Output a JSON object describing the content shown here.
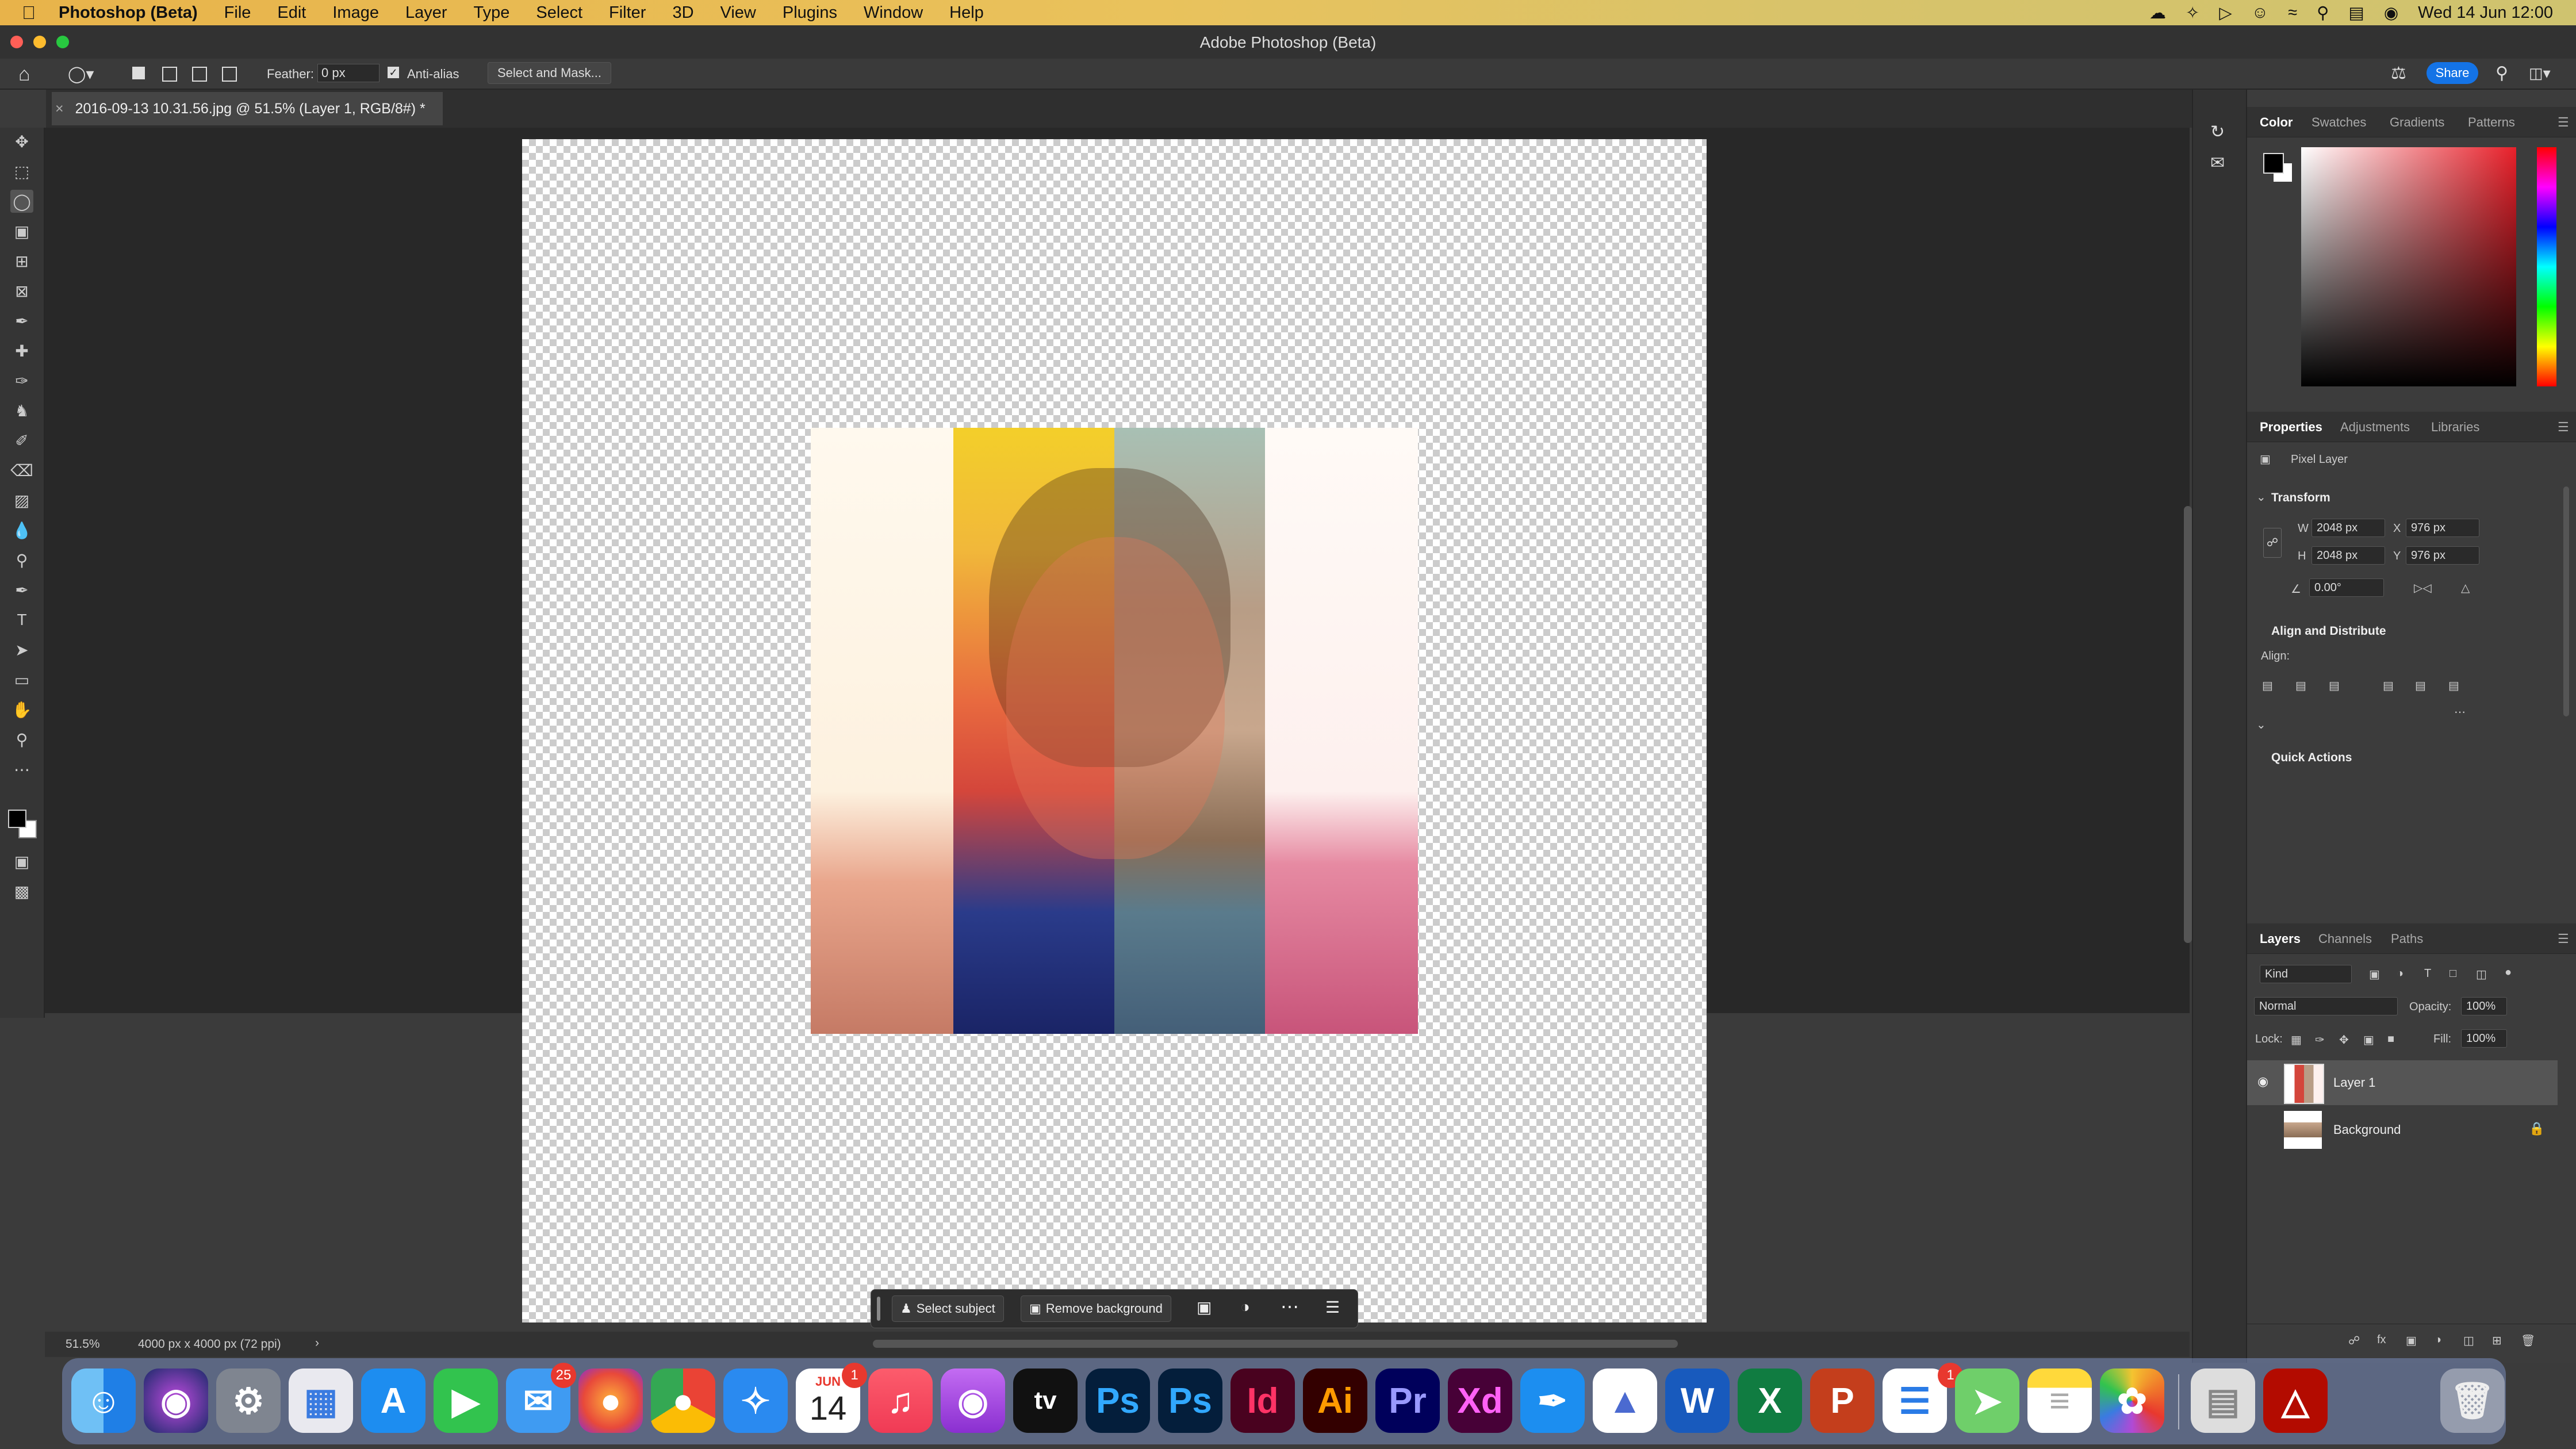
{
  "menubar": {
    "app_name": "Photoshop (Beta)",
    "items": [
      "File",
      "Edit",
      "Image",
      "Layer",
      "Type",
      "Select",
      "Filter",
      "3D",
      "View",
      "Plugins",
      "Window",
      "Help"
    ],
    "clock": "Wed 14 Jun  12:00"
  },
  "window": {
    "title": "Adobe Photoshop (Beta)"
  },
  "options": {
    "feather_label": "Feather:",
    "feather_value": "0 px",
    "antialias_label": "Anti-alias",
    "select_mask_label": "Select and Mask...",
    "share_label": "Share"
  },
  "document": {
    "tab_title": "2016-09-13 10.31.56.jpg @ 51.5% (Layer 1, RGB/8#) *"
  },
  "status": {
    "zoom": "51.5%",
    "doc_info": "4000 px x 4000 px (72 ppi)"
  },
  "context_bar": {
    "select_subject": "Select subject",
    "remove_background": "Remove background"
  },
  "color_panel": {
    "tabs": [
      "Color",
      "Swatches",
      "Gradients",
      "Patterns"
    ]
  },
  "properties": {
    "tabs": [
      "Properties",
      "Adjustments",
      "Libraries"
    ],
    "layer_type": "Pixel Layer",
    "transform_label": "Transform",
    "w_label": "W",
    "w_value": "2048 px",
    "h_label": "H",
    "h_value": "2048 px",
    "x_label": "X",
    "x_value": "976 px",
    "y_label": "Y",
    "y_value": "976 px",
    "angle_value": "0.00°",
    "align_section": "Align and Distribute",
    "align_label": "Align:",
    "quick_actions": "Quick Actions"
  },
  "layers_panel": {
    "tabs": [
      "Layers",
      "Channels",
      "Paths"
    ],
    "kind_label": "Kind",
    "blend_mode": "Normal",
    "opacity_label": "Opacity:",
    "opacity_value": "100%",
    "lock_label": "Lock:",
    "fill_label": "Fill:",
    "fill_value": "100%",
    "layers": [
      {
        "name": "Layer 1",
        "visible": true,
        "selected": true
      },
      {
        "name": "Background",
        "visible": false,
        "locked": true
      }
    ]
  },
  "dock": {
    "apps": [
      "Finder",
      "Siri",
      "System Settings",
      "Launchpad",
      "App Store",
      "FaceTime",
      "Mail",
      "Firefox",
      "Chrome",
      "Safari",
      "Calendar",
      "Music",
      "Podcasts",
      "TV",
      "Photoshop",
      "Photoshop Beta",
      "InDesign",
      "Illustrator",
      "Premiere Pro",
      "XD",
      "Pages Pen",
      "Affinity",
      "Word",
      "Excel",
      "PowerPoint",
      "Reminders",
      "Maps",
      "Notes",
      "Photos",
      "Preview",
      "Acrobat",
      "Trash"
    ],
    "mail_badge": "25",
    "calendar_month": "JUN",
    "calendar_day": "14",
    "calendar_badge": "1",
    "reminders_badge": "1",
    "tv_label": "tv",
    "ps_label": "Ps",
    "id_label": "Id",
    "ai_label": "Ai",
    "pr_label": "Pr",
    "xd_label": "Xd"
  },
  "colors": {
    "accent": "#1473e6",
    "panel": "#3c3c3c",
    "menubar": "#e8b34a"
  }
}
